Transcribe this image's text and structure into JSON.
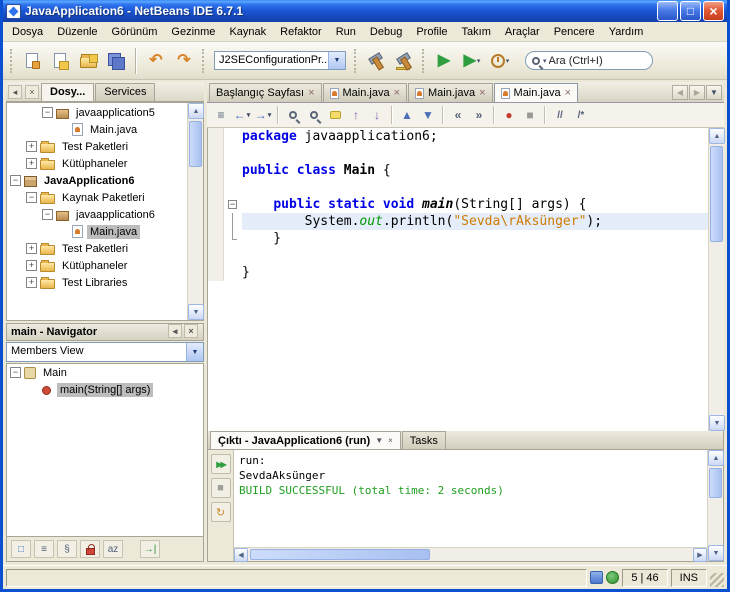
{
  "window": {
    "title": "JavaApplication6 - NetBeans IDE 6.7.1"
  },
  "menubar": {
    "items": [
      "Dosya",
      "Düzenle",
      "Görünüm",
      "Gezinme",
      "Kaynak",
      "Refaktor",
      "Run",
      "Debug",
      "Profile",
      "Takım",
      "Araçlar",
      "Pencere",
      "Yardım"
    ]
  },
  "toolbar": {
    "config_value": "J2SEConfigurationPr...",
    "search_value": "Ara (Ctrl+I)"
  },
  "sidebar": {
    "tabs": {
      "projects": "Dosy...",
      "services": "Services"
    },
    "projects_tree": [
      {
        "label": "javaapplication5",
        "level": 2,
        "icon": "package",
        "handle": "minus"
      },
      {
        "label": "Main.java",
        "level": 3,
        "icon": "java"
      },
      {
        "label": "Test Paketleri",
        "level": 1,
        "icon": "folder",
        "handle": "plus"
      },
      {
        "label": "Kütüphaneler",
        "level": 1,
        "icon": "folder",
        "handle": "plus"
      },
      {
        "label": "JavaApplication6",
        "level": 0,
        "icon": "project",
        "handle": "minus",
        "bold": true
      },
      {
        "label": "Kaynak Paketleri",
        "level": 1,
        "icon": "folder",
        "handle": "minus"
      },
      {
        "label": "javaapplication6",
        "level": 2,
        "icon": "package",
        "handle": "minus"
      },
      {
        "label": "Main.java",
        "level": 3,
        "icon": "java",
        "selected": true
      },
      {
        "label": "Test Paketleri",
        "level": 1,
        "icon": "folder",
        "handle": "plus"
      },
      {
        "label": "Kütüphaneler",
        "level": 1,
        "icon": "folder",
        "handle": "plus"
      },
      {
        "label": "Test Libraries",
        "level": 1,
        "icon": "folder",
        "handle": "plus"
      }
    ],
    "navigator": {
      "title": "main - Navigator",
      "view": "Members View",
      "items": [
        {
          "label": "Main",
          "level": 0,
          "icon": "class",
          "handle": "minus"
        },
        {
          "label": "main(String[] args)",
          "level": 1,
          "icon": "method",
          "selected": true
        }
      ]
    }
  },
  "editor": {
    "tabs": [
      {
        "label": "Başlangıç Sayfası"
      },
      {
        "label": "Main.java",
        "icon": "java"
      },
      {
        "label": "Main.java",
        "icon": "java"
      },
      {
        "label": "Main.java",
        "icon": "java",
        "active": true
      }
    ],
    "code": [
      {
        "tokens": [
          [
            "kw",
            "package"
          ],
          [
            "pl",
            " javaapplication6;"
          ]
        ]
      },
      {
        "tokens": []
      },
      {
        "tokens": [
          [
            "kw",
            "public class "
          ],
          [
            "type",
            "Main"
          ],
          [
            "pl",
            " {"
          ]
        ]
      },
      {
        "tokens": []
      },
      {
        "fold": "start",
        "tokens": [
          [
            "pl",
            "    "
          ],
          [
            "kw",
            "public static void "
          ],
          [
            "meth",
            "main"
          ],
          [
            "pl",
            "(String[] args) {"
          ]
        ]
      },
      {
        "fold": "mid",
        "highlight": true,
        "tokens": [
          [
            "pl",
            "        System."
          ],
          [
            "field",
            "out"
          ],
          [
            "pl",
            ".println("
          ],
          [
            "str",
            "\"Sevda\\rAksünger\""
          ],
          [
            "pl",
            ");"
          ]
        ]
      },
      {
        "fold": "end",
        "tokens": [
          [
            "pl",
            "    }"
          ]
        ]
      },
      {
        "tokens": []
      },
      {
        "tokens": [
          [
            "pl",
            "}"
          ]
        ]
      }
    ]
  },
  "output": {
    "tab_output": "Çıktı - JavaApplication6 (run)",
    "tab_tasks": "Tasks",
    "lines": [
      {
        "text": "run:",
        "type": "info"
      },
      {
        "text": "SevdaAksünger",
        "type": "plain"
      },
      {
        "text": "BUILD SUCCESSFUL (total time: 2 seconds)",
        "type": "success"
      }
    ]
  },
  "statusbar": {
    "caret": "5 | 46",
    "mode": "INS"
  },
  "icons": {
    "minimize": {
      "glyph": "_"
    },
    "maximize": {
      "glyph": "□"
    },
    "close": {
      "glyph": "×"
    },
    "undo": {
      "glyph": "↶",
      "color": "#D9842A"
    },
    "redo": {
      "glyph": "↷",
      "color": "#D9842A"
    },
    "run": {
      "glyph": "▶",
      "color": "#2E9E3E"
    },
    "debug": {
      "glyph": "▶",
      "color": "#2E9E3E"
    },
    "combo-arrow": {
      "glyph": "▼"
    },
    "group-minimize": {
      "glyph": "◂"
    },
    "group-close": {
      "glyph": "×"
    },
    "scroll-up": {
      "glyph": "▲"
    },
    "scroll-down": {
      "glyph": "▼"
    },
    "scroll-left": {
      "glyph": "◀"
    },
    "scroll-right": {
      "glyph": "▶"
    },
    "tab-left": {
      "glyph": "◀"
    },
    "tab-right": {
      "glyph": "▶"
    },
    "tab-list": {
      "glyph": "▼"
    },
    "history": {
      "glyph": "≡"
    },
    "back": {
      "glyph": "←",
      "color": "#3C66C4"
    },
    "forward": {
      "glyph": "→",
      "color": "#3C66C4"
    },
    "prev-occurrence": {
      "glyph": "↑",
      "color": "#7A5FB0"
    },
    "next-occurrence": {
      "glyph": "↓",
      "color": "#7A5FB0"
    },
    "prev-bookmark": {
      "glyph": "▲",
      "color": "#4A6FB8"
    },
    "next-bookmark": {
      "glyph": "▼",
      "color": "#4A6FB8"
    },
    "shift-left": {
      "glyph": "«"
    },
    "shift-right": {
      "glyph": "»"
    },
    "record-macro": {
      "glyph": "●",
      "color": "#C43C2C"
    },
    "stop-macro": {
      "glyph": "■",
      "color": "#9A9A96"
    },
    "comment": {
      "glyph": "//"
    },
    "uncomment": {
      "glyph": "/*"
    },
    "rerun": {
      "glyph": "▶▶",
      "color": "#2E9E3E"
    },
    "stop-output": {
      "glyph": "■",
      "color": "#A0A09A"
    },
    "rerun-options": {
      "glyph": "↻",
      "color": "#C98A2C"
    },
    "output-dropdown": {
      "glyph": "▼"
    },
    "filter-inherited": {
      "glyph": "□",
      "color": "#4A78C8"
    },
    "filter-fields": {
      "glyph": "≡"
    },
    "filter-static": {
      "glyph": "§"
    },
    "sort-alpha": {
      "glyph": "az"
    },
    "dock": {
      "glyph": "→|",
      "color": "#2E8E3E"
    }
  }
}
